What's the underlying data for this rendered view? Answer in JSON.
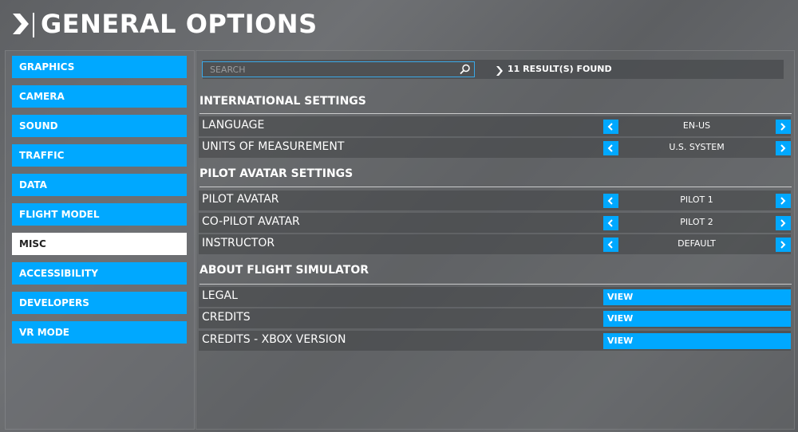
{
  "header": {
    "title": "GENERAL OPTIONS"
  },
  "colors": {
    "accent": "#00a8ff",
    "active_nav": "#ffffff"
  },
  "sidebar": {
    "items": [
      {
        "label": "GRAPHICS"
      },
      {
        "label": "CAMERA"
      },
      {
        "label": "SOUND"
      },
      {
        "label": "TRAFFIC"
      },
      {
        "label": "DATA"
      },
      {
        "label": "FLIGHT MODEL"
      },
      {
        "label": "MISC",
        "selected": true
      },
      {
        "label": "ACCESSIBILITY"
      },
      {
        "label": "DEVELOPERS"
      },
      {
        "label": "VR MODE"
      }
    ]
  },
  "search": {
    "placeholder": "SEARCH",
    "value": "",
    "results": "11 RESULT(S) FOUND"
  },
  "sections": [
    {
      "title": "INTERNATIONAL SETTINGS",
      "rows": [
        {
          "label": "LANGUAGE",
          "value": "EN-US"
        },
        {
          "label": "UNITS OF MEASUREMENT",
          "value": "U.S. SYSTEM"
        }
      ]
    },
    {
      "title": "PILOT AVATAR SETTINGS",
      "rows": [
        {
          "label": "PILOT AVATAR",
          "value": "PILOT 1"
        },
        {
          "label": "CO-PILOT AVATAR",
          "value": "PILOT 2"
        },
        {
          "label": "INSTRUCTOR",
          "value": "DEFAULT"
        }
      ]
    },
    {
      "title": "ABOUT FLIGHT SIMULATOR",
      "rows": [
        {
          "label": "LEGAL",
          "button": "VIEW"
        },
        {
          "label": "CREDITS",
          "button": "VIEW"
        },
        {
          "label": "CREDITS - XBOX VERSION",
          "button": "VIEW"
        }
      ]
    }
  ]
}
